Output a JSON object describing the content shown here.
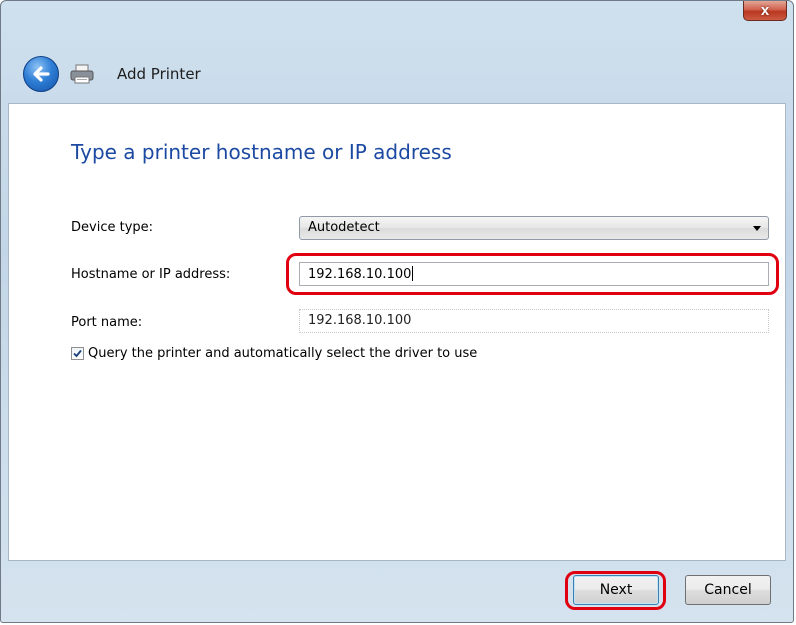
{
  "window": {
    "close_label": "x"
  },
  "nav": {
    "title": "Add Printer"
  },
  "page": {
    "heading": "Type a printer hostname or IP address"
  },
  "form": {
    "device_type_label": "Device type:",
    "device_type_value": "Autodetect",
    "hostname_label": "Hostname or IP address:",
    "hostname_value": "192.168.10.100",
    "port_label": "Port name:",
    "port_value": "192.168.10.100",
    "query_checkbox_label": "Query the printer and automatically select the driver to use",
    "query_checked": true
  },
  "footer": {
    "next_label": "Next",
    "cancel_label": "Cancel"
  },
  "colors": {
    "heading": "#1c4aa2",
    "highlight": "#e00010"
  },
  "icons": [
    "back-arrow-icon",
    "printer-icon",
    "close-icon",
    "dropdown-arrow-icon",
    "checkmark-icon"
  ]
}
